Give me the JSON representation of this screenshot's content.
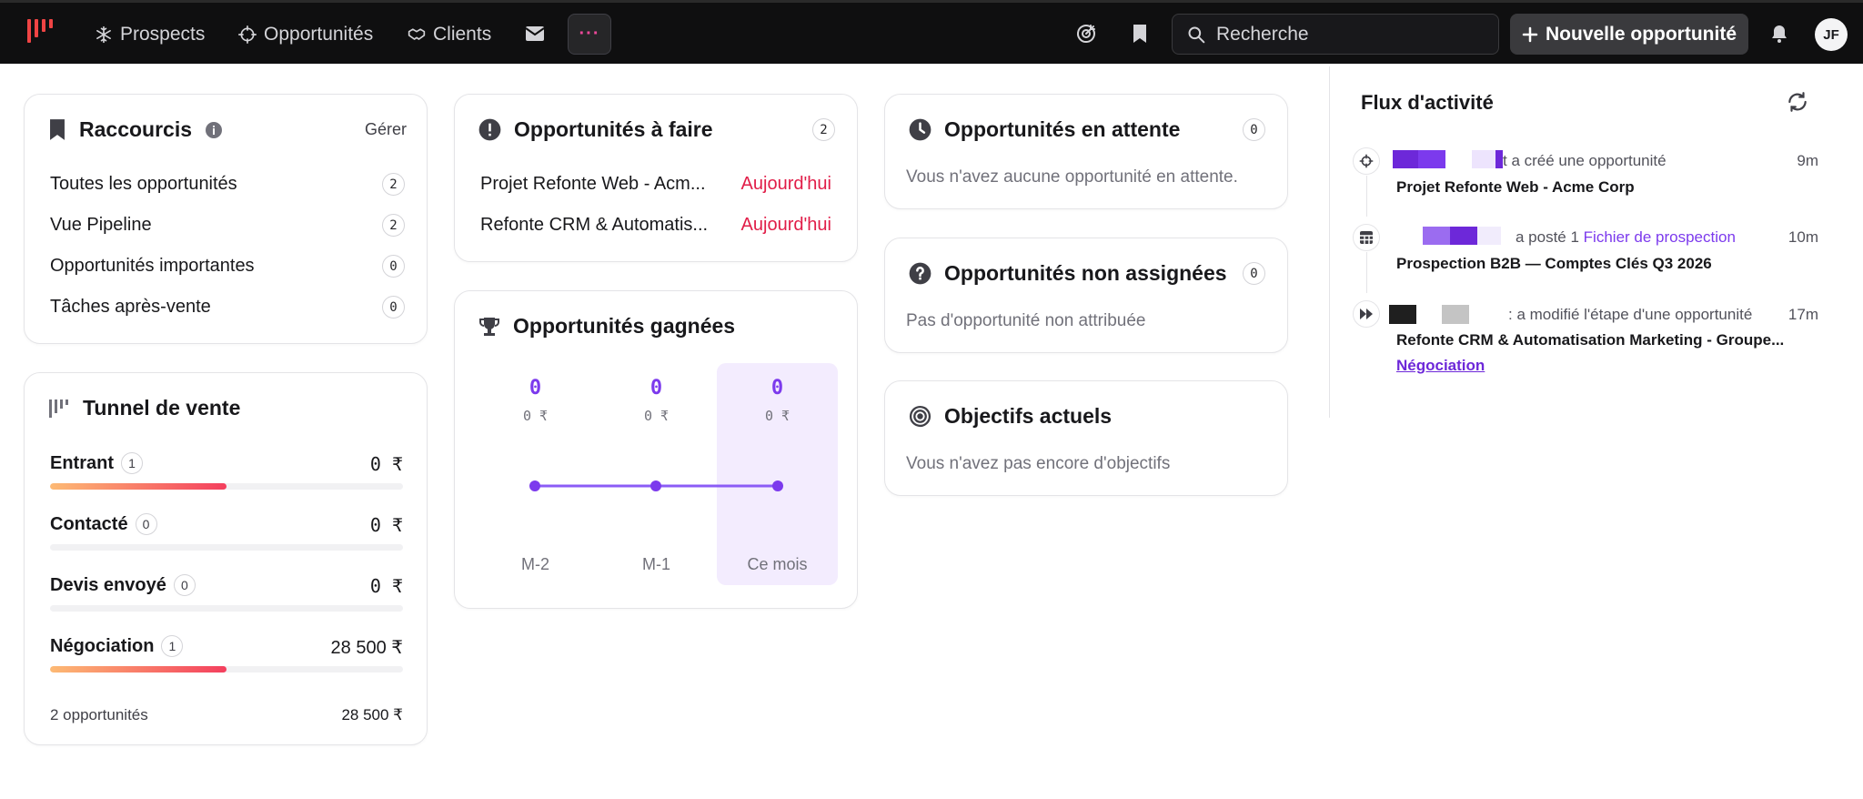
{
  "nav": {
    "logo": "app-logo",
    "items": [
      {
        "label": "Prospects",
        "icon": "snowflake-icon"
      },
      {
        "label": "Opportunités",
        "icon": "crosshair-icon"
      },
      {
        "label": "Clients",
        "icon": "handshake-icon"
      }
    ],
    "mail_icon": "mail-icon",
    "more_label": "···",
    "search_placeholder": "Recherche",
    "new_button_label": "Nouvelle opportunité",
    "avatar_initials": "JF"
  },
  "shortcuts": {
    "title": "Raccourcis",
    "manage": "Gérer",
    "items": [
      {
        "label": "Toutes les opportunités",
        "count": "2"
      },
      {
        "label": "Vue Pipeline",
        "count": "2"
      },
      {
        "label": "Opportunités importantes",
        "count": "0"
      },
      {
        "label": "Tâches après-vente",
        "count": "0"
      }
    ]
  },
  "funnel": {
    "title": "Tunnel de vente",
    "stages": [
      {
        "label": "Entrant",
        "count": "1",
        "value": "0 ₹",
        "fill": 0.5
      },
      {
        "label": "Contacté",
        "count": "0",
        "value": "0 ₹",
        "fill": 0
      },
      {
        "label": "Devis envoyé",
        "count": "0",
        "value": "0 ₹",
        "fill": 0
      },
      {
        "label": "Négociation",
        "count": "1",
        "value": "28 500 ₹",
        "fill": 0.5
      }
    ],
    "footer_label": "2 opportunités",
    "footer_value": "28 500 ₹"
  },
  "todo": {
    "title": "Opportunités à faire",
    "count": "2",
    "items": [
      {
        "label": "Projet Refonte Web - Acm...",
        "due": "Aujourd'hui"
      },
      {
        "label": "Refonte CRM & Automatis...",
        "due": "Aujourd'hui"
      }
    ]
  },
  "won": {
    "title": "Opportunités gagnées",
    "columns": [
      {
        "label": "M-2",
        "count": "0",
        "amount": "0 ₹"
      },
      {
        "label": "M-1",
        "count": "0",
        "amount": "0 ₹"
      },
      {
        "label": "Ce mois",
        "count": "0",
        "amount": "0 ₹"
      }
    ]
  },
  "waiting": {
    "title": "Opportunités en attente",
    "count": "0",
    "empty": "Vous n'avez aucune opportunité en attente."
  },
  "unassigned": {
    "title": "Opportunités non assignées",
    "count": "0",
    "empty": "Pas d'opportunité non attribuée"
  },
  "goals": {
    "title": "Objectifs actuels",
    "empty": "Vous n'avez pas encore d'objectifs"
  },
  "activity": {
    "title": "Flux d'activité",
    "items": [
      {
        "icon": "crosshair-icon",
        "prefix": "t",
        "action": " a créé une opportunité",
        "link": "",
        "time": "9m",
        "subject": "Projet Refonte Web - Acme Corp",
        "extra": ""
      },
      {
        "icon": "table-icon",
        "prefix": "",
        "action": "a posté 1 ",
        "link": "Fichier de prospection",
        "time": "10m",
        "subject": "Prospection B2B — Comptes Clés Q3 2026",
        "extra": ""
      },
      {
        "icon": "fast-forward-icon",
        "prefix": "",
        "action": ": a modifié l'étape d'une opportunité",
        "link": "",
        "time": "17m",
        "subject": "Refonte CRM & Automatisation Marketing - Groupe...",
        "extra": "Négociation"
      }
    ]
  },
  "colors": {
    "accent": "#7c3aed",
    "danger": "#e11d48",
    "nav_bg": "#0f0f10",
    "logo": "#ef4444"
  }
}
